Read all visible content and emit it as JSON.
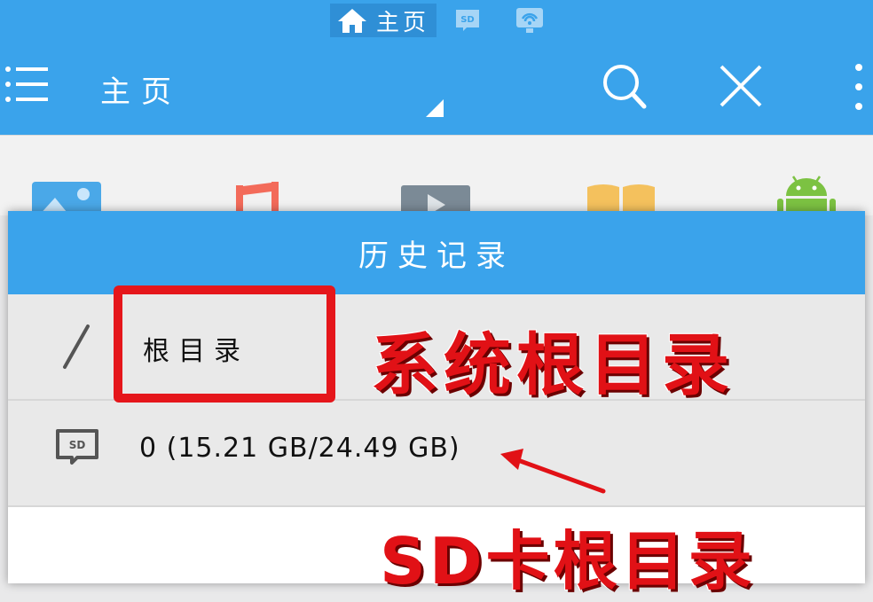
{
  "topbar": {
    "tabs": [
      {
        "label": "主页",
        "icon": "home-icon",
        "active": true
      },
      {
        "label": "",
        "icon": "sd-card-icon",
        "active": false
      },
      {
        "label": "",
        "icon": "remote-wifi-icon",
        "active": false
      }
    ],
    "title": "主页",
    "actions": [
      "search-icon",
      "close-icon",
      "more-vert-icon"
    ]
  },
  "categories": [
    "image-icon",
    "music-icon",
    "video-icon",
    "book-icon",
    "android-icon"
  ],
  "dialog": {
    "title": "历史记录",
    "items": [
      {
        "path": "/",
        "label": "根目录",
        "icon": "slash-icon"
      },
      {
        "label": "0 (15.21 GB/24.49 GB)",
        "icon": "sd-card-icon"
      }
    ]
  },
  "annotations": {
    "system_root": "系统根目录",
    "sd_root": "SD卡根目录"
  },
  "colors": {
    "primary": "#3aa3eb",
    "annotation_red": "#e11116"
  }
}
